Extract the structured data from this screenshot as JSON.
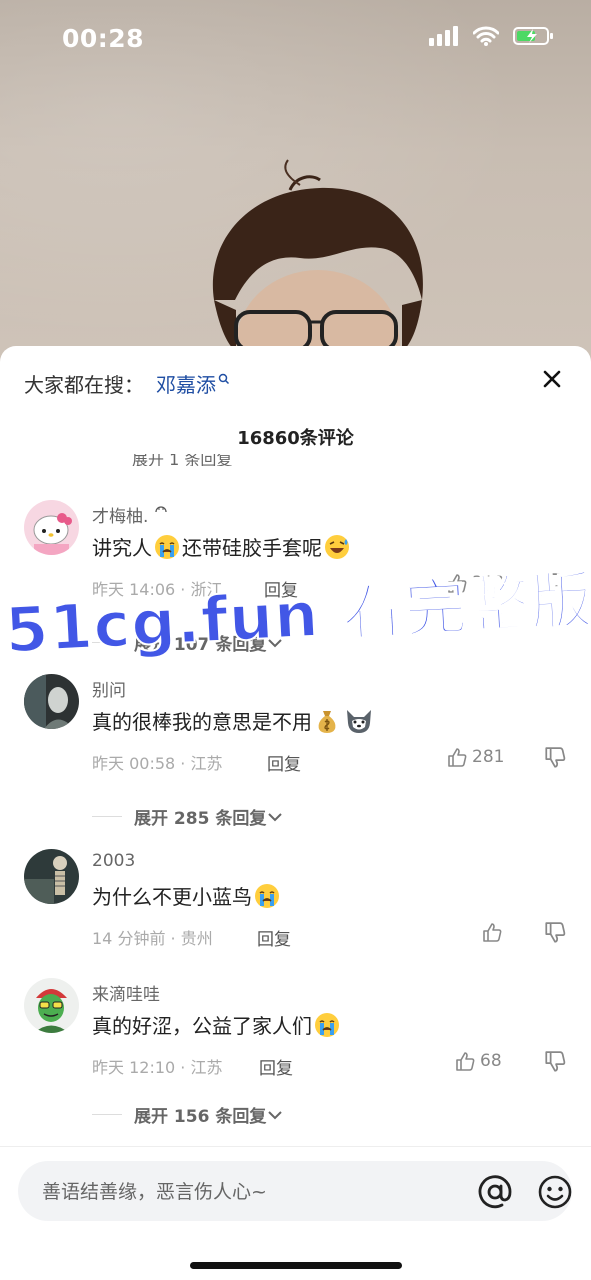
{
  "status_bar": {
    "time": "00:28"
  },
  "sheet": {
    "search_prefix": "大家都在搜：",
    "search_term": "邓嘉添",
    "title": "16860条评论",
    "clipped_reply": "展开 1 条回复"
  },
  "comments": [
    {
      "username": "才梅柚.",
      "text_parts": [
        "讲究人",
        "还带硅胶手套呢"
      ],
      "time_location": "昨天 14:06 · 浙江",
      "reply": "回复",
      "likes": "310",
      "expand": "展开 107 条回复"
    },
    {
      "username": "别问",
      "text_parts": [
        "真的很棒我的意思是不用"
      ],
      "time_location": "昨天 00:58 · 江苏",
      "reply": "回复",
      "likes": "281",
      "expand": "展开 285 条回复"
    },
    {
      "username": "2003",
      "text_parts": [
        "为什么不更小蓝鸟"
      ],
      "time_location": "14 分钟前 · 贵州",
      "reply": "回复",
      "likes": ""
    },
    {
      "username": "来滴哇哇",
      "text_parts": [
        "真的好涩，公益了家人们"
      ],
      "time_location": "昨天 12:10 · 江苏",
      "reply": "回复",
      "likes": "68",
      "expand": "展开 156 条回复"
    }
  ],
  "watermark": "51cg.fun  看完整版",
  "input": {
    "placeholder": "善语结善缘，恶言伤人心~"
  },
  "colors": {
    "accent": "#1f4ea3",
    "watermark": "#4257e6",
    "battery": "#4cd964"
  }
}
